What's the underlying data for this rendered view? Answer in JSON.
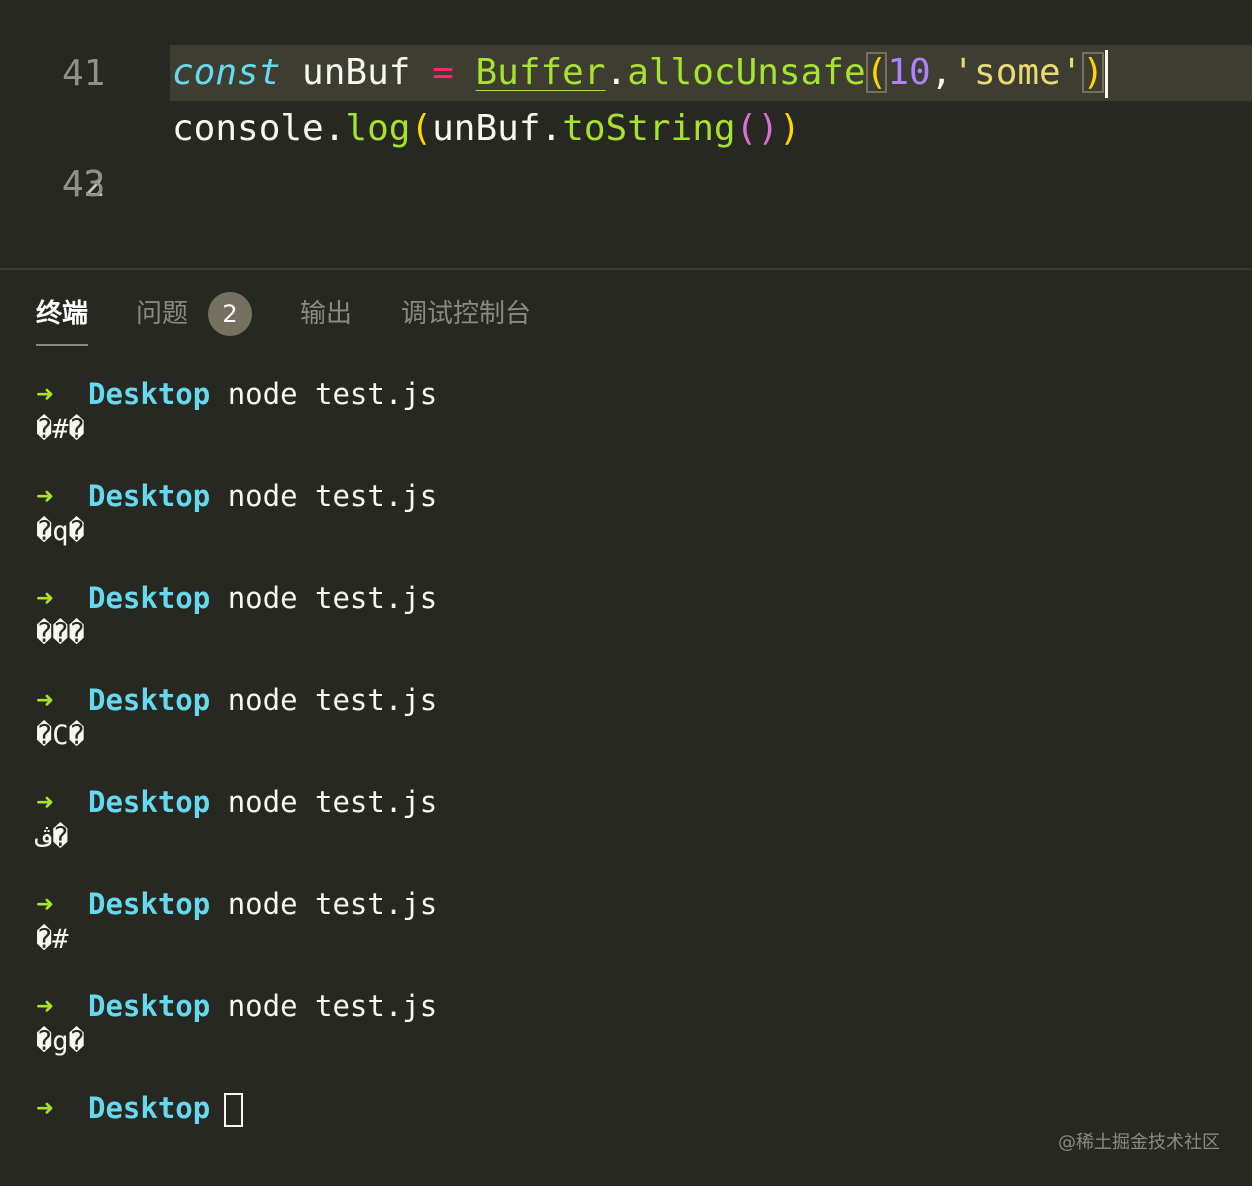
{
  "editor": {
    "lines": [
      {
        "number": "41"
      },
      {
        "number": "42",
        "tokens": {
          "kw": "const",
          "var": " unBuf ",
          "op": "=",
          "sp": " ",
          "cls": "Buffer",
          "dot": ".",
          "method": "allocUnsafe",
          "open": "(",
          "num": "10",
          "comma": ",",
          "str": "'some'",
          "close": ")"
        }
      },
      {
        "number": "43",
        "tokens": {
          "obj": "console",
          "dot": ".",
          "fn": "log",
          "open": "(",
          "arg": "unBuf",
          "dot2": ".",
          "fn2": "toString",
          "open2": "(",
          "close2": ")",
          "close": ")"
        }
      }
    ]
  },
  "panel": {
    "tabs": [
      {
        "label": "终端"
      },
      {
        "label": "问题",
        "badge": "2"
      },
      {
        "label": "输出"
      },
      {
        "label": "调试控制台"
      }
    ]
  },
  "terminal": {
    "arrow": "➜",
    "entries": [
      {
        "dir": "Desktop",
        "cmd": "node test.js",
        "output": "�#�"
      },
      {
        "dir": "Desktop",
        "cmd": "node test.js",
        "output": "�q�"
      },
      {
        "dir": "Desktop",
        "cmd": "node test.js",
        "output": "���"
      },
      {
        "dir": "Desktop",
        "cmd": "node test.js",
        "output": "�C�"
      },
      {
        "dir": "Desktop",
        "cmd": "node test.js",
        "output": "ڤ�"
      },
      {
        "dir": "Desktop",
        "cmd": "node test.js",
        "output": "�#"
      },
      {
        "dir": "Desktop",
        "cmd": "node test.js",
        "output": "�g�"
      }
    ],
    "last_prompt": {
      "dir": "Desktop"
    }
  },
  "watermark": "@稀土掘金技术社区"
}
